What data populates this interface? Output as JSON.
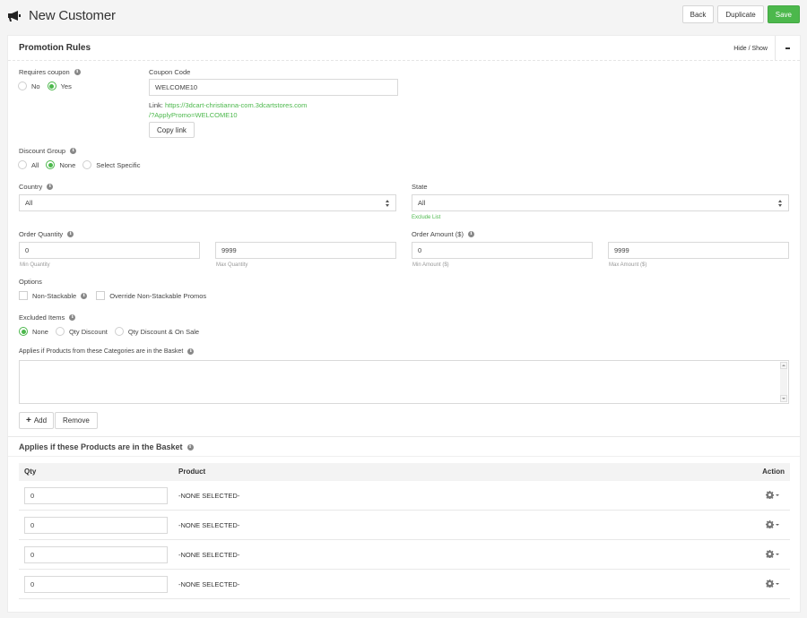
{
  "header": {
    "title": "New Customer",
    "icon": "megaphone-icon",
    "buttons": {
      "back": "Back",
      "duplicate": "Duplicate",
      "save": "Save"
    }
  },
  "colors": {
    "accent": "#4cb84c",
    "background": "#f4f4f4",
    "card": "#ffffff"
  },
  "card": {
    "title": "Promotion Rules",
    "hide_show": "Hide / Show"
  },
  "requires_coupon": {
    "label": "Requires coupon",
    "options": [
      "No",
      "Yes"
    ],
    "selected": "Yes"
  },
  "coupon_code": {
    "label": "Coupon Code",
    "value": "WELCOME10",
    "link_prefix": "Link:",
    "link_line1": "https://3dcart-christianna-com.3dcartstores.com",
    "link_line2": "/?ApplyPromo=WELCOME10",
    "copy_button": "Copy link"
  },
  "discount_group": {
    "label": "Discount Group",
    "options": [
      "All",
      "None",
      "Select Specific"
    ],
    "selected": "None"
  },
  "country": {
    "label": "Country",
    "value": "All"
  },
  "state": {
    "label": "State",
    "value": "All",
    "exclude_link": "Exclude List"
  },
  "order_quantity": {
    "label": "Order Quantity",
    "min_value": "0",
    "max_value": "9999",
    "min_hint": "Min Quantity",
    "max_hint": "Max Quantity"
  },
  "order_amount": {
    "label": "Order Amount ($)",
    "min_value": "0",
    "max_value": "9999",
    "min_hint": "Min Amount ($)",
    "max_hint": "Max Amount ($)"
  },
  "options": {
    "label": "Options",
    "non_stackable": "Non-Stackable",
    "override": "Override Non-Stackable Promos"
  },
  "excluded_items": {
    "label": "Excluded Items",
    "options": [
      "None",
      "Qty Discount",
      "Qty Discount & On Sale"
    ],
    "selected": "None"
  },
  "categories": {
    "label": "Applies if Products from these Categories are in the Basket",
    "add_button": "Add",
    "remove_button": "Remove"
  },
  "products": {
    "title": "Applies if these Products are in the Basket",
    "columns": [
      "Qty",
      "Product",
      "Action"
    ],
    "rows": [
      {
        "qty": "0",
        "product": "-NONE SELECTED-"
      },
      {
        "qty": "0",
        "product": "-NONE SELECTED-"
      },
      {
        "qty": "0",
        "product": "-NONE SELECTED-"
      },
      {
        "qty": "0",
        "product": "-NONE SELECTED-"
      }
    ]
  }
}
